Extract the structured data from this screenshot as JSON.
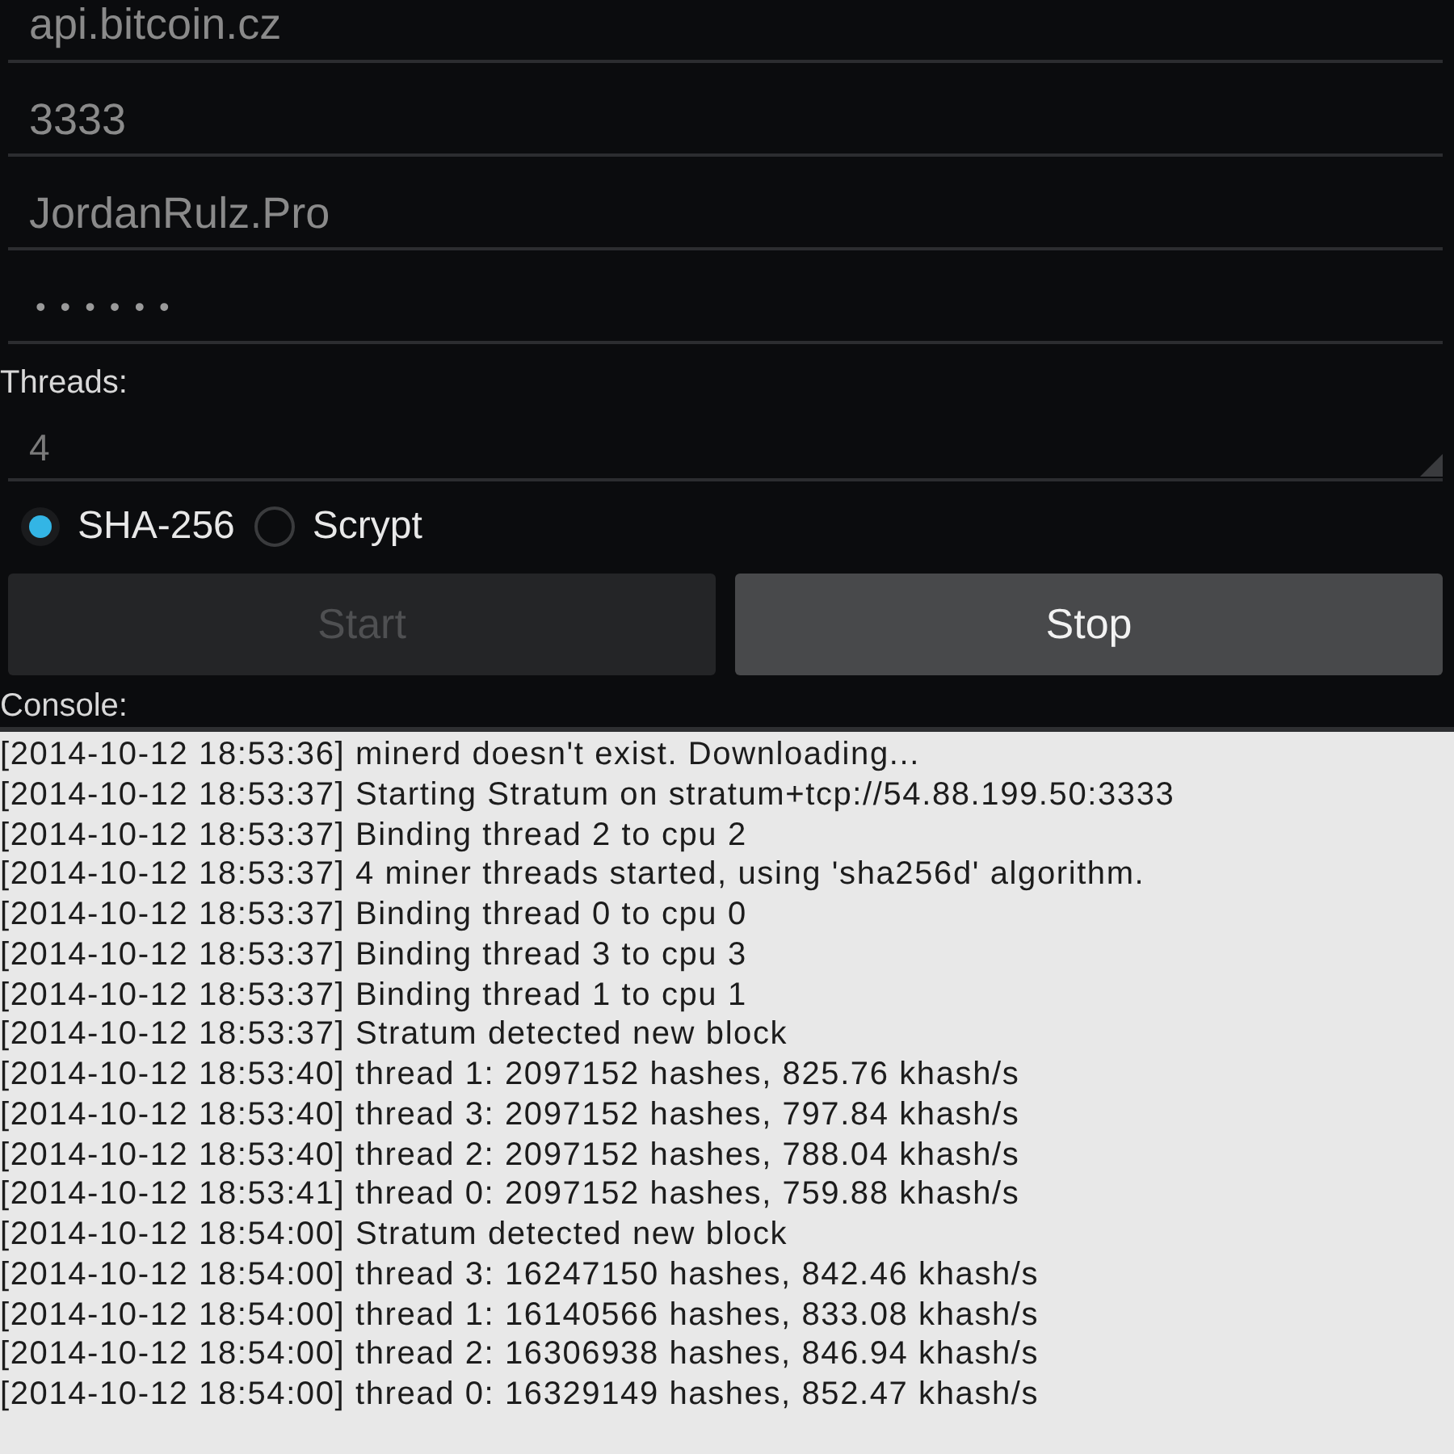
{
  "fields": [
    {
      "kind": "text",
      "value": "api.bitcoin.cz"
    },
    {
      "kind": "text",
      "value": "3333"
    },
    {
      "kind": "text",
      "value": "JordanRulz.Pro"
    },
    {
      "kind": "password",
      "value": "••••••"
    }
  ],
  "threads": {
    "label": "Threads:",
    "value": "4"
  },
  "algorithms": [
    {
      "label": "SHA-256",
      "selected": true
    },
    {
      "label": "Scrypt",
      "selected": false
    }
  ],
  "buttons": [
    {
      "label": "Start",
      "disabled": true
    },
    {
      "label": "Stop",
      "disabled": false
    }
  ],
  "console": {
    "label": "Console:",
    "lines": [
      "[2014-10-12 18:53:36] minerd doesn't exist. Downloading...",
      "[2014-10-12 18:53:37] Starting Stratum on stratum+tcp://54.88.199.50:3333",
      "[2014-10-12 18:53:37] Binding thread 2 to cpu 2",
      "[2014-10-12 18:53:37] 4 miner threads started, using 'sha256d' algorithm.",
      "[2014-10-12 18:53:37] Binding thread 0 to cpu 0",
      "[2014-10-12 18:53:37] Binding thread 3 to cpu 3",
      "[2014-10-12 18:53:37] Binding thread 1 to cpu 1",
      "[2014-10-12 18:53:37] Stratum detected new block",
      "[2014-10-12 18:53:40] thread 1: 2097152 hashes, 825.76 khash/s",
      "[2014-10-12 18:53:40] thread 3: 2097152 hashes, 797.84 khash/s",
      "[2014-10-12 18:53:40] thread 2: 2097152 hashes, 788.04 khash/s",
      "[2014-10-12 18:53:41] thread 0: 2097152 hashes, 759.88 khash/s",
      "[2014-10-12 18:54:00] Stratum detected new block",
      "[2014-10-12 18:54:00] thread 3: 16247150 hashes, 842.46 khash/s",
      "[2014-10-12 18:54:00] thread 1: 16140566 hashes, 833.08 khash/s",
      "[2014-10-12 18:54:00] thread 2: 16306938 hashes, 846.94 khash/s",
      "[2014-10-12 18:54:00] thread 0: 16329149 hashes, 852.47 khash/s"
    ]
  }
}
